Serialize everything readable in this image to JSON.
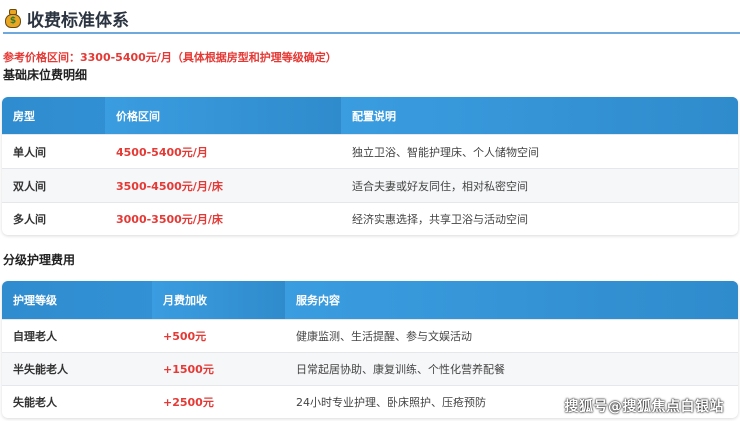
{
  "title": "收费标准体系",
  "title_icon": "money-bag-icon",
  "note": "参考价格区间：3300-5400元/月（具体根据房型和护理等级确定）",
  "bed_section": {
    "heading": "基础床位费明细",
    "headers": [
      "房型",
      "价格区间",
      "配置说明"
    ],
    "rows": [
      {
        "type": "单人间",
        "price": "4500-5400元/月",
        "desc": "独立卫浴、智能护理床、个人储物空间"
      },
      {
        "type": "双人间",
        "price": "3500-4500元/月/床",
        "desc": "适合夫妻或好友同住，相对私密空间"
      },
      {
        "type": "多人间",
        "price": "3000-3500元/月/床",
        "desc": "经济实惠选择，共享卫浴与活动空间"
      }
    ]
  },
  "care_section": {
    "heading": "分级护理费用",
    "headers": [
      "护理等级",
      "月费加收",
      "服务内容"
    ],
    "rows": [
      {
        "level": "自理老人",
        "fee": "+500元",
        "desc": "健康监测、生活提醒、参与文娱活动"
      },
      {
        "level": "半失能老人",
        "fee": "+1500元",
        "desc": "日常起居协助、康复训练、个性化营养配餐"
      },
      {
        "level": "失能老人",
        "fee": "+2500元",
        "desc": "24小时专业护理、卧床照护、压疮预防"
      }
    ]
  },
  "watermark": "搜狐号@搜狐焦点白银站",
  "colors": {
    "accent": "#3598db",
    "price": "#e53935"
  }
}
